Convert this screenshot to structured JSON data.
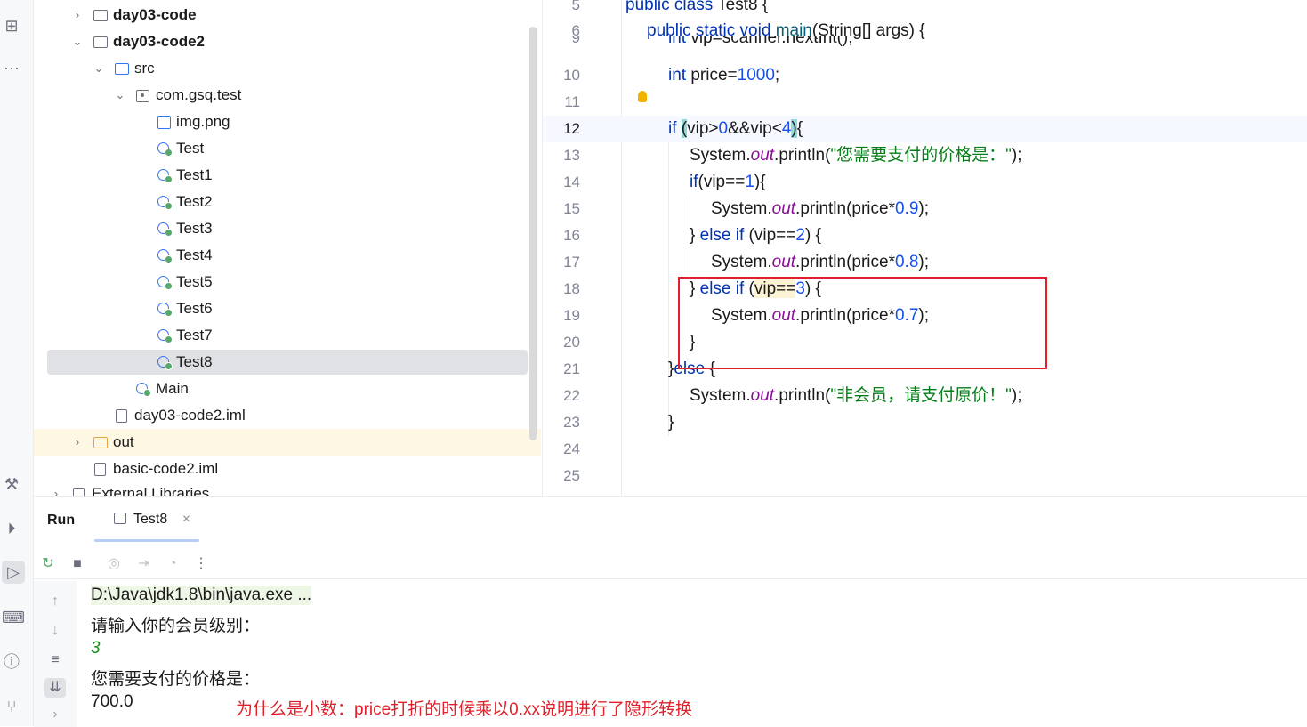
{
  "toolstrip": {
    "icons": [
      "structure-icon",
      "more-icon",
      "build-icon",
      "services-icon",
      "run-icon",
      "terminal-icon",
      "problems-icon",
      "git-icon"
    ]
  },
  "tree": {
    "rows": [
      {
        "label": "day03-code",
        "bold": true
      },
      {
        "label": "day03-code2",
        "bold": true
      },
      {
        "label": "src"
      },
      {
        "label": "com.gsq.test"
      },
      {
        "label": "img.png"
      },
      {
        "label": "Test"
      },
      {
        "label": "Test1"
      },
      {
        "label": "Test2"
      },
      {
        "label": "Test3"
      },
      {
        "label": "Test4"
      },
      {
        "label": "Test5"
      },
      {
        "label": "Test6"
      },
      {
        "label": "Test7"
      },
      {
        "label": "Test8",
        "selected": true
      },
      {
        "label": "Main"
      },
      {
        "label": "day03-code2.iml"
      },
      {
        "label": "out"
      },
      {
        "label": "basic-code2.iml"
      },
      {
        "label": "External Libraries"
      }
    ]
  },
  "editor": {
    "lines": [
      {
        "n": "5"
      },
      {
        "n": "6"
      },
      {
        "n": "9"
      },
      {
        "n": "10"
      },
      {
        "n": "11"
      },
      {
        "n": "12"
      },
      {
        "n": "13"
      },
      {
        "n": "14"
      },
      {
        "n": "15"
      },
      {
        "n": "16"
      },
      {
        "n": "17"
      },
      {
        "n": "18"
      },
      {
        "n": "19"
      },
      {
        "n": "20"
      },
      {
        "n": "21"
      },
      {
        "n": "22"
      },
      {
        "n": "23"
      },
      {
        "n": "24"
      },
      {
        "n": "25"
      }
    ],
    "code": {
      "l5_kw": "public class ",
      "l5_name": "Test8 {",
      "l6_kw": "public static void ",
      "l6_fn": "main",
      "l6_rest": "(String[] args) {",
      "l9_kw": "int ",
      "l9_rest": "vip=scanner.nextInt();",
      "l10_kw": "int ",
      "l10_a": "price=",
      "l10_num": "1000",
      "l10_b": ";",
      "l12_kw": "if ",
      "l12_p": "(",
      "l12_a": "vip>",
      "l12_n1": "0",
      "l12_b": "&&vip<",
      "l12_n2": "4",
      "l12_p2": ")",
      "l12_c": "{",
      "l13_a": "System.",
      "l13_out": "out",
      "l13_b": ".println(",
      "l13_str": "\"您需要支付的价格是：\"",
      "l13_c": ");",
      "l14_kw": "if",
      "l14_a": "(vip==",
      "l14_n": "1",
      "l14_b": "){",
      "l15_a": "System.",
      "l15_out": "out",
      "l15_b": ".println(price*",
      "l15_n": "0.9",
      "l15_c": ");",
      "l16_a": "} ",
      "l16_kw": "else if ",
      "l16_b": "(vip==",
      "l16_n": "2",
      "l16_c": ") {",
      "l17_a": "System.",
      "l17_out": "out",
      "l17_b": ".println(price*",
      "l17_n": "0.8",
      "l17_c": ");",
      "l18_a": "} ",
      "l18_kw": "else if ",
      "l18_b": "(",
      "l18_v": "vip==",
      "l18_n": "3",
      "l18_c": ") {",
      "l19_a": "System.",
      "l19_out": "out",
      "l19_b": ".println(price*",
      "l19_n": "0.7",
      "l19_c": ");",
      "l20": "}",
      "l21_a": "}",
      "l21_kw": "else ",
      "l21_b": "{",
      "l22_a": "System.",
      "l22_out": "out",
      "l22_b": ".println(",
      "l22_str": "\"非会员，请支付原价！\"",
      "l22_c": ");",
      "l23": "}"
    }
  },
  "run": {
    "title": "Run",
    "tab_label": "Test8",
    "tab_close": "×",
    "console": {
      "cmd": "D:\\Java\\jdk1.8\\bin\\java.exe ...",
      "prompt": "请输入你的会员级别：",
      "input": "3",
      "msg": "您需要支付的价格是：",
      "result": "700.0"
    },
    "note": "为什么是小数：price打折的时候乘以0.xx说明进行了隐形转换"
  },
  "colors": {
    "keyword": "#0033b3",
    "number": "#1750eb",
    "string": "#067d17",
    "static_field": "#871094",
    "annotation_red": "#e0202a"
  }
}
